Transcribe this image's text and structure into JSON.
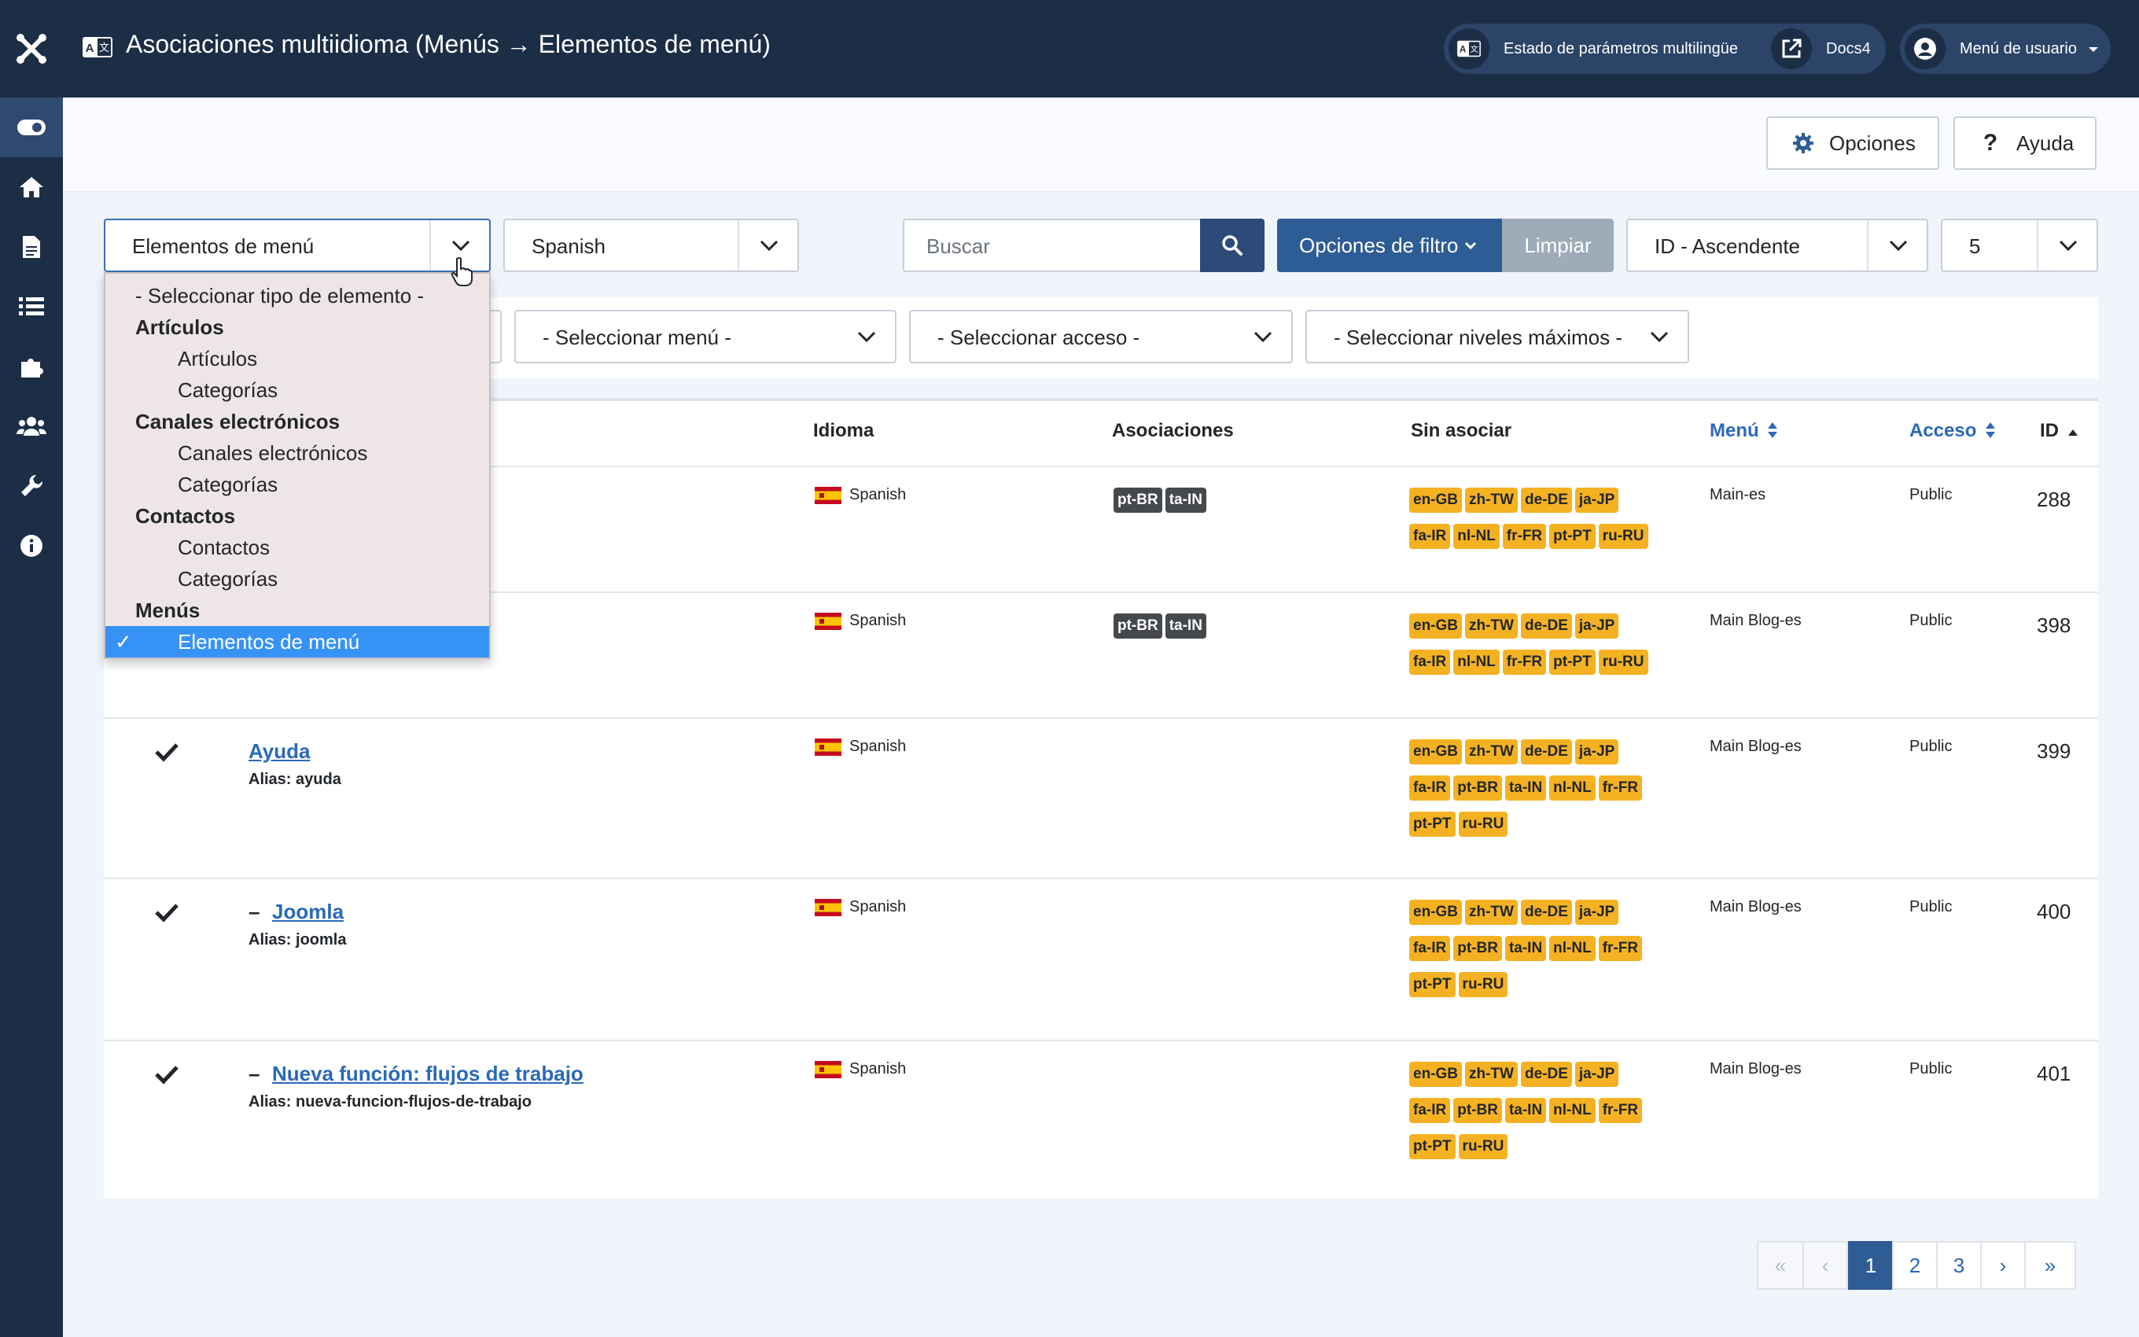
{
  "header": {
    "title": "Asociaciones multiidioma (Menús → Elementos de menú)",
    "multilingual_status": "Estado de parámetros multilingüe",
    "docs": "Docs4",
    "user_menu": "Menú de usuario"
  },
  "toolbar": {
    "options_label": "Opciones",
    "help_label": "Ayuda"
  },
  "filters": {
    "item_type_value": "Elementos de menú",
    "language_value": "Spanish",
    "search_placeholder": "Buscar",
    "filter_options_label": "Opciones de filtro",
    "clear_label": "Limpiar",
    "ordering_value": "ID - Ascendente",
    "limit_value": "5",
    "menu_value": "- Seleccionar menú -",
    "access_value": "- Seleccionar acceso -",
    "levels_value": "- Seleccionar niveles máximos -"
  },
  "dropdown": {
    "placeholder": "- Seleccionar tipo de elemento -",
    "groups": [
      {
        "label": "Artículos",
        "options": [
          "Artículos",
          "Categorías"
        ]
      },
      {
        "label": "Canales electrónicos",
        "options": [
          "Canales electrónicos",
          "Categorías"
        ]
      },
      {
        "label": "Contactos",
        "options": [
          "Contactos",
          "Categorías"
        ]
      },
      {
        "label": "Menús",
        "options": [
          "Elementos de menú"
        ]
      }
    ],
    "selected_tick": "✓"
  },
  "table": {
    "columns": {
      "language": "Idioma",
      "associations": "Asociaciones",
      "unassociated": "Sin asociar",
      "menu": "Menú",
      "access": "Acceso",
      "id": "ID"
    },
    "rows": [
      {
        "title": "",
        "prefix": "",
        "alias": "",
        "language": "Spanish",
        "associations": [
          "pt-BR",
          "ta-IN"
        ],
        "unassociated": [
          "en-GB",
          "zh-TW",
          "de-DE",
          "ja-JP",
          "fa-IR",
          "nl-NL",
          "fr-FR",
          "pt-PT",
          "ru-RU"
        ],
        "menu": "Main-es",
        "access": "Public",
        "id": "288"
      },
      {
        "title": "",
        "prefix": "",
        "alias": "",
        "language": "Spanish",
        "associations": [
          "pt-BR",
          "ta-IN"
        ],
        "unassociated": [
          "en-GB",
          "zh-TW",
          "de-DE",
          "ja-JP",
          "fa-IR",
          "nl-NL",
          "fr-FR",
          "pt-PT",
          "ru-RU"
        ],
        "menu": "Main Blog-es",
        "access": "Public",
        "id": "398"
      },
      {
        "title": "Ayuda",
        "prefix": "",
        "alias": "Alias: ayuda",
        "language": "Spanish",
        "associations": [],
        "unassociated": [
          "en-GB",
          "zh-TW",
          "de-DE",
          "ja-JP",
          "fa-IR",
          "pt-BR",
          "ta-IN",
          "nl-NL",
          "fr-FR",
          "pt-PT",
          "ru-RU"
        ],
        "menu": "Main Blog-es",
        "access": "Public",
        "id": "399"
      },
      {
        "title": "Joomla",
        "prefix": "–",
        "alias": "Alias: joomla",
        "language": "Spanish",
        "associations": [],
        "unassociated": [
          "en-GB",
          "zh-TW",
          "de-DE",
          "ja-JP",
          "fa-IR",
          "pt-BR",
          "ta-IN",
          "nl-NL",
          "fr-FR",
          "pt-PT",
          "ru-RU"
        ],
        "menu": "Main Blog-es",
        "access": "Public",
        "id": "400"
      },
      {
        "title": "Nueva función: flujos de trabajo",
        "prefix": "–",
        "alias": "Alias: nueva-funcion-flujos-de-trabajo",
        "language": "Spanish",
        "associations": [],
        "unassociated": [
          "en-GB",
          "zh-TW",
          "de-DE",
          "ja-JP",
          "fa-IR",
          "pt-BR",
          "ta-IN",
          "nl-NL",
          "fr-FR",
          "pt-PT",
          "ru-RU"
        ],
        "menu": "Main Blog-es",
        "access": "Public",
        "id": "401"
      }
    ]
  },
  "pagination": {
    "first": "«",
    "prev": "‹",
    "pages": [
      "1",
      "2",
      "3"
    ],
    "current": "1",
    "next": "›",
    "last": "»"
  },
  "colors": {
    "navy": "#1c2d46",
    "accent": "#2e5c94",
    "link": "#2a69b8",
    "badge_warning": "#f4b223",
    "badge_dark": "#45494e",
    "dropdown_selected": "#3792f5"
  }
}
